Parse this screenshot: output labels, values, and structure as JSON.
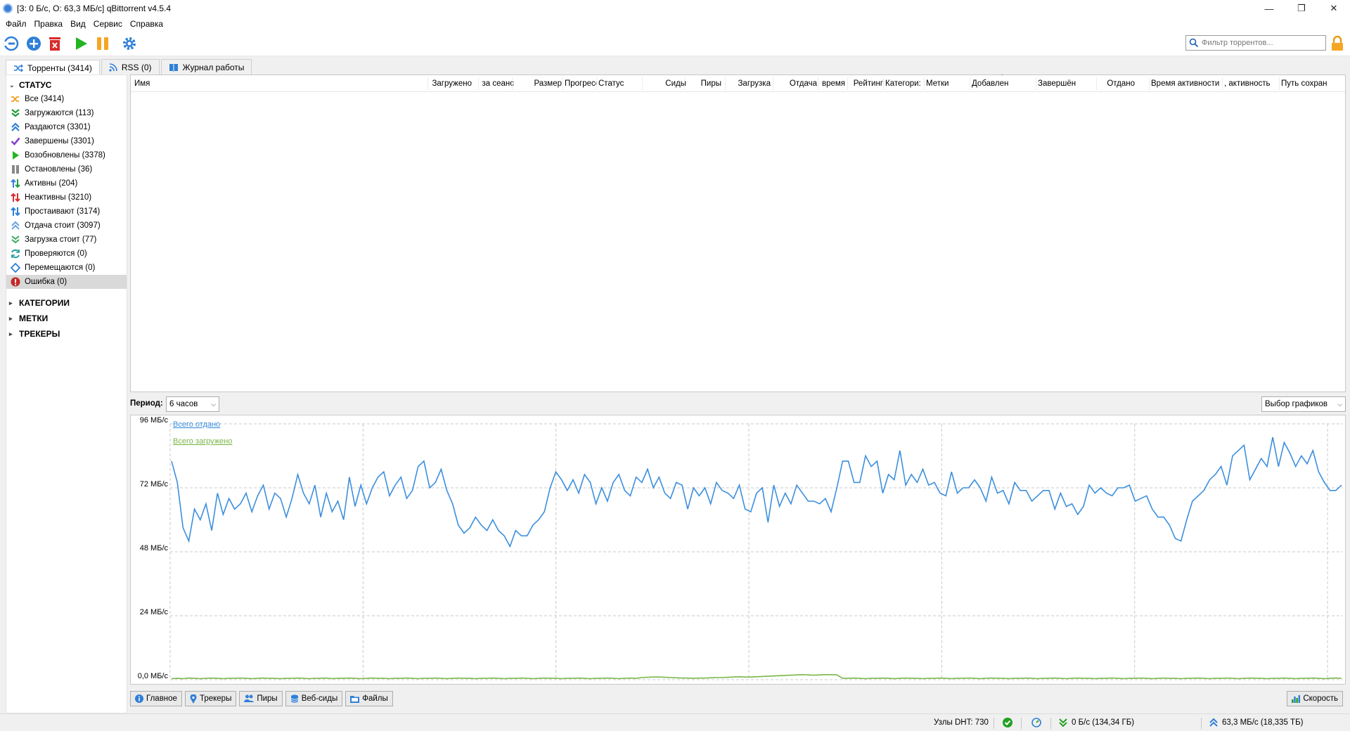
{
  "window": {
    "title": "[З: 0 Б/с, О: 63,3 МБ/с] qBittorrent v4.5.4"
  },
  "menu": [
    "Файл",
    "Правка",
    "Вид",
    "Сервис",
    "Справка"
  ],
  "toolbar": {
    "icons": [
      "add-link-icon",
      "add-torrent-icon",
      "delete-icon",
      "resume-icon",
      "pause-icon",
      "settings-icon"
    ],
    "search_placeholder": "Фильтр торрентов..."
  },
  "tabs": [
    {
      "label": "Торренты (3414)",
      "icon": "shuffle-icon"
    },
    {
      "label": "RSS (0)",
      "icon": "rss-icon"
    },
    {
      "label": "Журнал работы",
      "icon": "book-icon"
    }
  ],
  "sidebar": {
    "status_header": "СТАТУС",
    "items": [
      {
        "label": "Все (3414)",
        "icon": "all-icon"
      },
      {
        "label": "Загружаются (113)",
        "icon": "downloading-icon"
      },
      {
        "label": "Раздаются (3301)",
        "icon": "seeding-icon"
      },
      {
        "label": "Завершены (3301)",
        "icon": "completed-icon"
      },
      {
        "label": "Возобновлены (3378)",
        "icon": "resumed-icon"
      },
      {
        "label": "Остановлены (36)",
        "icon": "paused-icon"
      },
      {
        "label": "Активны (204)",
        "icon": "active-icon"
      },
      {
        "label": "Неактивны (3210)",
        "icon": "inactive-icon"
      },
      {
        "label": "Простаивают (3174)",
        "icon": "stalled-icon"
      },
      {
        "label": "Отдача стоит (3097)",
        "icon": "stalled-upload-icon"
      },
      {
        "label": "Загрузка стоит (77)",
        "icon": "stalled-download-icon"
      },
      {
        "label": "Проверяются (0)",
        "icon": "checking-icon"
      },
      {
        "label": "Перемещаются (0)",
        "icon": "moving-icon"
      },
      {
        "label": "Ошибка (0)",
        "icon": "error-icon"
      }
    ],
    "selected_index": 13,
    "categories_header": "КАТЕГОРИИ",
    "tags_header": "МЕТКИ",
    "trackers_header": "ТРЕКЕРЫ"
  },
  "columns": [
    "Имя",
    "Загружено",
    "за сеанс",
    "Размер",
    "Прогресс",
    "Статус",
    "Сиды",
    "Пиры",
    "Загрузка",
    "Отдача",
    "время",
    "Рейтинг",
    "Категори:",
    "Метки",
    "Добавлен",
    "Завершён",
    "Отдано",
    "Время активности",
    ", активность",
    "Путь сохран"
  ],
  "period": {
    "label": "Период:",
    "value": "6 часов",
    "graphs_button": "Выбор графиков"
  },
  "chart_data": {
    "type": "line",
    "y_ticks": [
      "96 МБ/с",
      "72 МБ/с",
      "48 МБ/с",
      "24 МБ/с",
      "0,0 МБ/с"
    ],
    "ylim": [
      0,
      96
    ],
    "unit": "МБ/с",
    "grid": true,
    "legend_placement": "top-left",
    "series": [
      {
        "name": "Всего отдано",
        "color": "#3c8fde",
        "values": [
          82,
          74,
          57,
          52,
          64,
          60,
          66,
          56,
          70,
          62,
          68,
          64,
          66,
          70,
          63,
          69,
          73,
          64,
          70,
          68,
          61,
          68,
          77,
          70,
          66,
          73,
          61,
          70,
          63,
          67,
          60,
          76,
          65,
          73,
          66,
          72,
          76,
          78,
          69,
          73,
          76,
          68,
          71,
          80,
          82,
          72,
          74,
          79,
          71,
          66,
          58,
          55,
          57,
          61,
          58,
          56,
          60,
          56,
          54,
          50,
          56,
          54,
          54,
          58,
          60,
          63,
          72,
          78,
          75,
          71,
          75,
          70,
          77,
          74,
          66,
          72,
          67,
          74,
          77,
          71,
          69,
          76,
          74,
          79,
          72,
          76,
          70,
          68,
          74,
          73,
          64,
          72,
          69,
          72,
          66,
          74,
          71,
          70,
          68,
          73,
          64,
          63,
          70,
          72,
          59,
          73,
          65,
          70,
          66,
          73,
          70,
          67,
          67,
          66,
          68,
          63,
          72,
          82,
          82,
          74,
          74,
          84,
          80,
          82,
          70,
          77,
          75,
          86,
          73,
          77,
          74,
          79,
          73,
          74,
          70,
          69,
          78,
          70,
          72,
          72,
          75,
          72,
          67,
          76,
          70,
          71,
          66,
          74,
          71,
          71,
          67,
          69,
          71,
          71,
          64,
          70,
          65,
          66,
          62,
          65,
          73,
          70,
          72,
          70,
          69,
          72,
          72,
          73,
          67,
          68,
          69,
          64,
          61,
          61,
          58,
          53,
          52,
          60,
          67,
          69,
          71,
          75,
          77,
          80,
          73,
          84,
          86,
          88,
          75,
          79,
          83,
          80,
          91,
          80,
          89,
          85,
          80,
          84,
          81,
          86,
          78,
          74,
          71,
          71,
          73
        ]
      },
      {
        "name": "Всего загружено",
        "color": "#7ab648",
        "values": [
          0.4,
          0.5,
          0.4,
          0.6,
          0.5,
          0.4,
          0.5,
          0.6,
          0.5,
          0.4,
          0.5,
          0.5,
          0.6,
          0.5,
          0.4,
          0.5,
          0.6,
          0.5,
          0.5,
          0.4,
          0.5,
          0.5,
          0.6,
          0.5,
          0.4,
          0.5,
          0.5,
          0.6,
          0.4,
          0.5,
          0.5,
          0.6,
          0.5,
          0.4,
          0.5,
          0.6,
          0.5,
          0.5,
          0.4,
          0.5,
          0.5,
          0.6,
          0.5,
          0.4,
          0.5,
          0.5,
          0.6,
          0.5,
          0.4,
          0.5,
          0.6,
          0.5,
          0.5,
          0.4,
          0.5,
          0.5,
          0.6,
          0.5,
          0.4,
          0.5,
          0.5,
          0.6,
          0.5,
          0.4,
          0.5,
          0.6,
          0.5,
          0.5,
          0.4,
          0.5,
          0.5,
          0.6,
          0.5,
          0.4,
          0.5,
          0.5,
          0.6,
          0.5,
          0.4,
          0.5,
          0.6,
          0.5,
          0.8,
          0.9,
          1.0,
          1.0,
          0.9,
          0.8,
          0.7,
          0.6,
          0.6,
          0.5,
          0.6,
          0.6,
          0.7,
          0.8,
          0.8,
          0.9,
          1.0,
          1.1,
          1.0,
          1.0,
          1.1,
          1.2,
          1.3,
          1.4,
          1.5,
          1.6,
          1.7,
          1.8,
          1.9,
          1.8,
          1.7,
          1.8,
          1.9,
          1.9,
          1.8,
          0.5,
          0.5,
          0.6,
          0.5,
          0.4,
          0.5,
          0.5,
          0.6,
          0.5,
          0.4,
          0.5,
          0.6,
          0.5,
          0.5,
          0.4,
          0.5,
          0.5,
          0.6,
          0.5,
          0.4,
          0.5,
          0.5,
          0.6,
          0.5,
          0.4,
          0.5,
          0.6,
          0.5,
          0.5,
          0.4,
          0.5,
          0.5,
          0.6,
          0.5,
          0.4,
          0.5,
          0.5,
          0.6,
          0.5,
          0.4,
          0.5,
          0.6,
          0.5,
          0.5,
          0.4,
          0.5,
          0.5,
          0.6,
          0.5,
          0.4,
          0.5,
          0.5,
          0.6,
          0.5,
          0.4,
          0.5,
          0.6,
          0.5,
          0.5,
          0.4,
          0.5,
          0.5,
          0.6,
          0.5,
          0.4,
          0.5,
          0.5,
          0.6,
          0.5,
          0.4,
          0.5,
          0.6,
          0.5,
          0.5,
          0.4,
          0.5,
          0.5,
          0.6,
          0.5,
          0.4,
          0.5,
          0.5,
          0.6,
          0.5,
          0.4,
          0.5,
          0.6,
          0.5
        ]
      }
    ]
  },
  "bottom_tabs": [
    {
      "label": "Главное",
      "icon": "info-icon"
    },
    {
      "label": "Трекеры",
      "icon": "pin-icon"
    },
    {
      "label": "Пиры",
      "icon": "peers-icon"
    },
    {
      "label": "Веб-сиды",
      "icon": "database-icon"
    },
    {
      "label": "Файлы",
      "icon": "folder-icon"
    }
  ],
  "speed_button": "Скорость",
  "status": {
    "dht": "Узлы DHT: 730",
    "download": "0 Б/с (134,34 ГБ)",
    "upload": "63,3 МБ/с (18,335 ТБ)"
  }
}
